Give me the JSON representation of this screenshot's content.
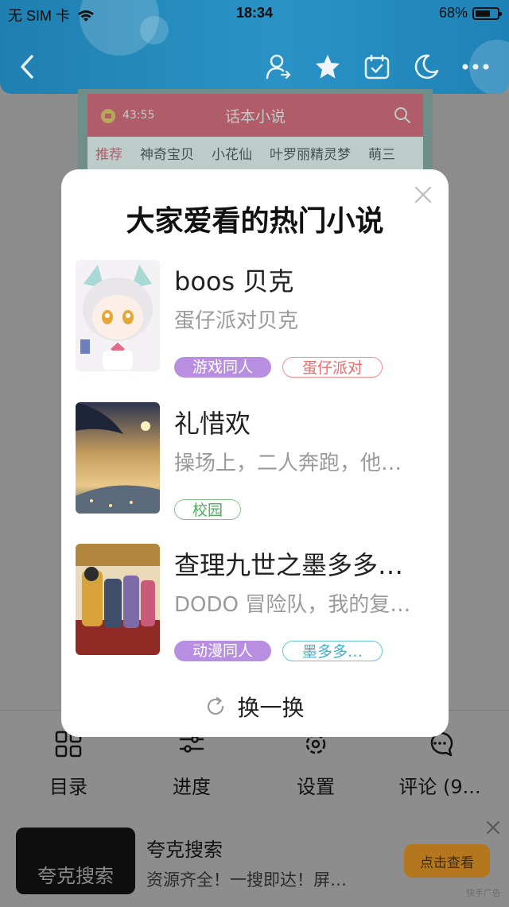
{
  "status_bar": {
    "carrier": "无 SIM 卡",
    "time": "18:34",
    "battery": "68%",
    "battery_level": 0.68
  },
  "preview": {
    "timer": "43:55",
    "title": "话本小说",
    "tabs": [
      "推荐",
      "神奇宝贝",
      "小花仙",
      "叶罗丽精灵梦",
      "萌三"
    ]
  },
  "modal": {
    "title": "大家爱看的热门小说",
    "books": [
      {
        "title": "boos 贝克",
        "desc": "蛋仔派对贝克",
        "tags": [
          "游戏同人",
          "蛋仔派对"
        ]
      },
      {
        "title": "礼惜欢",
        "desc": "操场上，二人奔跑，他…",
        "tags": [
          "校园"
        ]
      },
      {
        "title": "查理九世之墨多多…",
        "desc": "DODO 冒险队，我的复…",
        "tags": [
          "动漫同人",
          "墨多多…"
        ]
      }
    ],
    "refresh_label": "换一换"
  },
  "toolbar": {
    "items": [
      "目录",
      "进度",
      "设置",
      "评论 (9..."
    ]
  },
  "ad": {
    "thumb_text": "夸克搜索",
    "title": "夸克搜索",
    "desc": "资源齐全！一搜即达！屏…",
    "button": "点击查看",
    "tag": "快手广告"
  }
}
